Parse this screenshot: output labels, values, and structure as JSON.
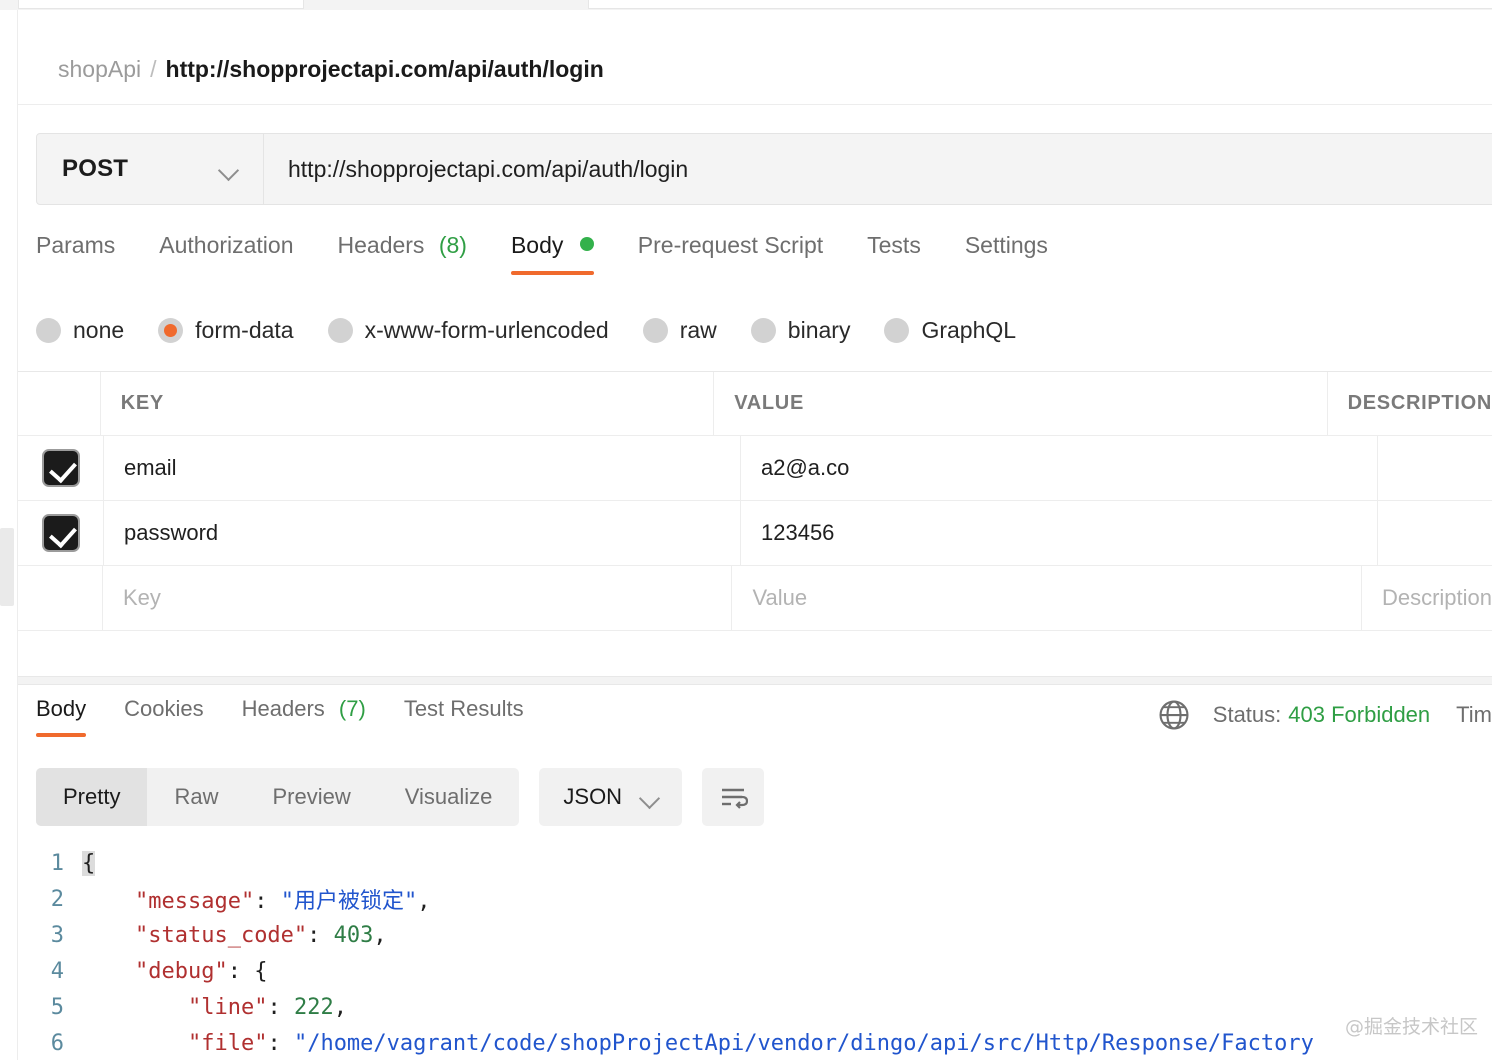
{
  "breadcrumb": {
    "collection": "shopApi",
    "separator": "/",
    "request_name": "http://shopprojectapi.com/api/auth/login"
  },
  "request_bar": {
    "method": "POST",
    "url": "http://shopprojectapi.com/api/auth/login"
  },
  "request_tabs": [
    {
      "label": "Params",
      "count": "",
      "active": false
    },
    {
      "label": "Authorization",
      "count": "",
      "active": false
    },
    {
      "label": "Headers",
      "count": "(8)",
      "active": false
    },
    {
      "label": "Body",
      "count": "",
      "active": true
    },
    {
      "label": "Pre-request Script",
      "count": "",
      "active": false
    },
    {
      "label": "Tests",
      "count": "",
      "active": false
    },
    {
      "label": "Settings",
      "count": "",
      "active": false
    }
  ],
  "body_modes": [
    {
      "label": "none",
      "selected": false
    },
    {
      "label": "form-data",
      "selected": true
    },
    {
      "label": "x-www-form-urlencoded",
      "selected": false
    },
    {
      "label": "raw",
      "selected": false
    },
    {
      "label": "binary",
      "selected": false
    },
    {
      "label": "GraphQL",
      "selected": false
    }
  ],
  "form_table": {
    "headers": {
      "key": "KEY",
      "value": "VALUE",
      "description": "DESCRIPTION"
    },
    "rows": [
      {
        "checked": true,
        "key": "email",
        "value": "a2@a.co",
        "description": ""
      },
      {
        "checked": true,
        "key": "password",
        "value": "123456",
        "description": ""
      }
    ],
    "placeholder_row": {
      "key": "Key",
      "value": "Value",
      "description": "Description"
    }
  },
  "response_tabs": [
    {
      "label": "Body",
      "count": "",
      "active": true
    },
    {
      "label": "Cookies",
      "count": "",
      "active": false
    },
    {
      "label": "Headers",
      "count": "(7)",
      "active": false
    },
    {
      "label": "Test Results",
      "count": "",
      "active": false
    }
  ],
  "response_meta": {
    "status_label": "Status:",
    "status_value": "403 Forbidden",
    "time_label": "Tim"
  },
  "response_toolbar": {
    "segments": [
      {
        "label": "Pretty",
        "active": true
      },
      {
        "label": "Raw",
        "active": false
      },
      {
        "label": "Preview",
        "active": false
      },
      {
        "label": "Visualize",
        "active": false
      }
    ],
    "format": "JSON"
  },
  "code": {
    "lines": [
      "1",
      "2",
      "3",
      "4",
      "5",
      "6"
    ],
    "l1_brace": "{",
    "l2_key": "\"message\"",
    "l2_colon": ": ",
    "l2_val": "\"用户被锁定\"",
    "l2_comma": ",",
    "l3_key": "\"status_code\"",
    "l3_colon": ": ",
    "l3_val": "403",
    "l3_comma": ",",
    "l4_key": "\"debug\"",
    "l4_colon": ": ",
    "l4_brace": "{",
    "l5_key": "\"line\"",
    "l5_colon": ": ",
    "l5_val": "222",
    "l5_comma": ",",
    "l6_key": "\"file\"",
    "l6_colon": ": ",
    "l6_val": "\"/home/vagrant/code/shopProjectApi/vendor/dingo/api/src/Http/Response/Factory"
  },
  "watermark": "@掘金技术社区",
  "colors": {
    "accent_orange": "#f06a2d",
    "status_green": "#2f9e44",
    "json_key": "#b03030",
    "json_string": "#2155cd",
    "json_number": "#2f7d46",
    "line_number": "#5b8a9e"
  }
}
